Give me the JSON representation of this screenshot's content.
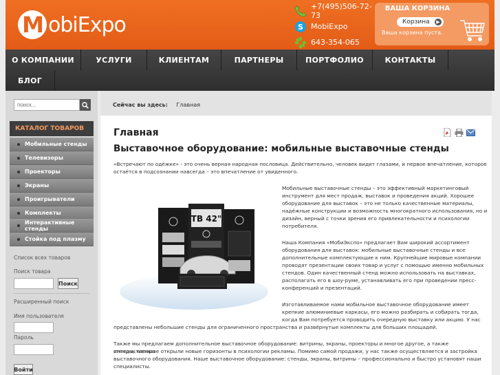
{
  "header": {
    "logo_m": "M",
    "logo_rest": "obiExpo",
    "contacts": [
      {
        "icon": "phone-icon",
        "text": "+7(495)506-72-73"
      },
      {
        "icon": "skype-icon",
        "text": "MobiExpo"
      },
      {
        "icon": "icq-icon",
        "text": "643-354-065"
      }
    ]
  },
  "cart": {
    "title": "ВАША КОРЗИНА",
    "button": "Корзина",
    "empty_text": "Ваша корзина пуста."
  },
  "nav": {
    "items": [
      "О КОМПАНИИ",
      "УСЛУГИ",
      "КЛИЕНТАМ",
      "ПАРТНЕРЫ",
      "ПОРТФОЛИО",
      "КОНТАКТЫ",
      "БЛОГ"
    ]
  },
  "sidebar": {
    "search_placeholder": "поиск...",
    "catalog_title": "КАТАЛОГ ТОВАРОВ",
    "catalog_items": [
      "Мобильные стенды",
      "Телевизоры",
      "Проекторы",
      "Экраны",
      "Проигрыватели",
      "Комплекты",
      "Интерактивные стенды",
      "Стойка под плазму"
    ],
    "all_products": "Список всех товаров",
    "product_search_label": "Поиск товара",
    "search_button": "Поиск",
    "advanced_search": "Расширенный поиск",
    "username_label": "Имя пользователя",
    "password_label": "Пароль",
    "login_button": "Войти"
  },
  "main": {
    "breadcrumb_label": "Сейчас вы здесь:",
    "breadcrumb_current": "Главная",
    "page_title": "Главная",
    "article_title": "Выставочное оборудование: мобильные выставочные стенды",
    "image_caption": "TB 42\"",
    "intro_lines": [
      "«Встречают по одёжке» - это очень верная народная пословица. Действительно, человек видит глазами, и первое впечатление, которое",
      "остаётся в подсознании навсегда – это впечатление от увиденного."
    ],
    "para1_lines": [
      "Мобильные выставочные стенды – это эффективный маркетинговый",
      "инструмент для мест продаж, выставок и проведения акций. Хорошее",
      "оборудование для выставок – это не только качественные материалы,",
      "надёжные конструкции и возможность многократного использования, но и",
      "дизайн, верный с точки зрения его привлекательности и психологии",
      "потребителя."
    ],
    "para2_lines": [
      "Наша Компания «МобиЭкспо» предлагает Вам широкий ассортимент",
      "оборудования для выставок: мобильные выставочные стенды и все",
      "дополнительные комплектующие к ним. Крупнейшие мировые компании",
      "проводят презентации своих товар и услуг с помощью именно мобильных",
      "стендов. Один качественный стенд можно использовать на выставках,",
      "располагать его в шоу-руме, устанавливать его при проведении пресс-",
      "конференций и презентаций."
    ],
    "para3_lines": [
      "Изготавливаемое нами мобильное выставочное оборудование имеет",
      "крепкие алюминиевые каркасы, его можно разбирать и собирать тогда,",
      "когда Вам потребуется проводить очередную выставку или акцию. У нас"
    ],
    "para3_tail": "представлены небольшие стенды для ограниченного пространства и развёрнутые комплекты для больших площадей.",
    "para4_lines": [
      "Также мы предлагаем дополнительное выставочное оборудование: витрины, экраны, проекторы и многое другое, а также интерактивные",
      "стенды, которые открыли новые горизонты в психологии рекламы. Помимо самой продажи, у нас также осуществляется и застройка",
      "выставочного оборудования. Наше выставочное оборудование: стенды, экраны, витрины – профессионально и быстро установят наши",
      "специалисты."
    ]
  },
  "colors": {
    "brand_orange": "#e8641e",
    "nav_dark": "#3a3a3a",
    "catalog_accent": "#f39b5f"
  }
}
